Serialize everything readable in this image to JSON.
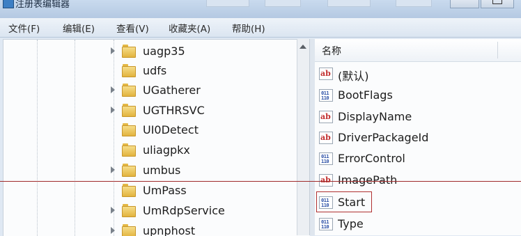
{
  "window": {
    "title": "注册表编辑器"
  },
  "menu": [
    {
      "label": "文件(F)"
    },
    {
      "label": "编辑(E)"
    },
    {
      "label": "查看(V)"
    },
    {
      "label": "收藏夹(A)"
    },
    {
      "label": "帮助(H)"
    }
  ],
  "tree": {
    "items": [
      {
        "label": "uagp35",
        "expandable": true
      },
      {
        "label": "udfs",
        "expandable": false
      },
      {
        "label": "UGatherer",
        "expandable": true
      },
      {
        "label": "UGTHRSVC",
        "expandable": true
      },
      {
        "label": "UI0Detect",
        "expandable": false
      },
      {
        "label": "uliagpkx",
        "expandable": false
      },
      {
        "label": "umbus",
        "expandable": true
      },
      {
        "label": "UmPass",
        "expandable": false
      },
      {
        "label": "UmRdpService",
        "expandable": true
      },
      {
        "label": "upnphost",
        "expandable": true
      }
    ]
  },
  "values_pane": {
    "column_name": "名称",
    "rows": [
      {
        "label": "(默认)",
        "type_icon": "string-value-icon"
      },
      {
        "label": "BootFlags",
        "type_icon": "binary-value-icon"
      },
      {
        "label": "DisplayName",
        "type_icon": "string-value-icon"
      },
      {
        "label": "DriverPackageId",
        "type_icon": "string-value-icon"
      },
      {
        "label": "ErrorControl",
        "type_icon": "binary-value-icon"
      },
      {
        "label": "ImagePath",
        "type_icon": "string-value-icon"
      },
      {
        "label": "Start",
        "type_icon": "binary-value-icon",
        "highlighted": true
      },
      {
        "label": "Type",
        "type_icon": "binary-value-icon"
      }
    ]
  },
  "colors": {
    "highlight": "#b03030",
    "guide_line": "#9e2a2a"
  }
}
